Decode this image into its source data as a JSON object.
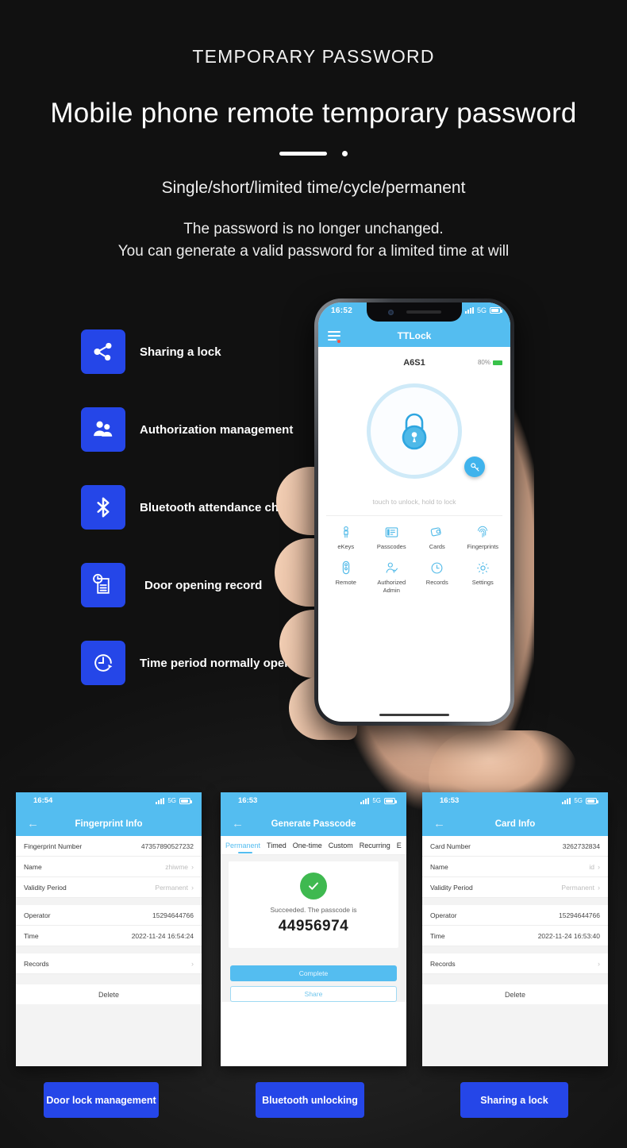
{
  "header": {
    "eyebrow": "TEMPORARY PASSWORD",
    "title": "Mobile phone remote temporary password",
    "subtitle": "Single/short/limited time/cycle/permanent",
    "desc_line1": "The password is no longer unchanged.",
    "desc_line2": "You can generate a valid password for a limited time at will"
  },
  "colors": {
    "background": "#111111",
    "brand_blue": "#2546e8",
    "app_blue": "#54bdf0",
    "success_green": "#3fb950"
  },
  "features": [
    {
      "icon": "share-icon",
      "label": "Sharing a lock"
    },
    {
      "icon": "users-icon",
      "label": "Authorization management"
    },
    {
      "icon": "bluetooth-icon",
      "label": "Bluetooth attendance check"
    },
    {
      "icon": "document-clock-icon",
      "label": "Door opening record"
    },
    {
      "icon": "clock-arrow-icon",
      "label": "Time period normally open"
    }
  ],
  "hero_phone": {
    "status": {
      "time": "16:52",
      "network": "5G",
      "signal": "signal-bars-icon",
      "battery": "battery-icon"
    },
    "appbar": {
      "menu": "hamburger-icon",
      "title": "TTLock"
    },
    "lock": {
      "name": "A6S1",
      "battery_percent": "80%",
      "hint": "touch to unlock, hold to lock",
      "lock_icon": "padlock-icon",
      "fab_icon": "key-icon"
    },
    "grid": [
      {
        "icon": "ekey-icon",
        "label": "eKeys"
      },
      {
        "icon": "passcode-icon",
        "label": "Passcodes"
      },
      {
        "icon": "card-icon",
        "label": "Cards"
      },
      {
        "icon": "fingerprint-icon",
        "label": "Fingerprints"
      },
      {
        "icon": "remote-icon",
        "label": "Remote"
      },
      {
        "icon": "admin-icon",
        "label": "Authorized\nAdmin"
      },
      {
        "icon": "history-icon",
        "label": "Records"
      },
      {
        "icon": "gear-icon",
        "label": "Settings"
      }
    ]
  },
  "shots": {
    "fingerprint": {
      "status_time": "16:54",
      "network": "5G",
      "title": "Fingerprint Info",
      "rows": [
        {
          "label": "Fingerprint Number",
          "value": "47357890527232",
          "muted": false,
          "chevron": false
        },
        {
          "label": "Name",
          "value": "zhiwme",
          "muted": true,
          "chevron": true
        },
        {
          "label": "Validity Period",
          "value": "Permanent",
          "muted": true,
          "chevron": true
        },
        {
          "label": "Operator",
          "value": "15294644766",
          "muted": false,
          "chevron": false
        },
        {
          "label": "Time",
          "value": "2022-11-24 16:54:24",
          "muted": false,
          "chevron": false
        },
        {
          "label": "Records",
          "value": "",
          "muted": false,
          "chevron": true
        }
      ],
      "delete": "Delete"
    },
    "passcode": {
      "status_time": "16:53",
      "network": "5G",
      "title": "Generate Passcode",
      "tabs": [
        "Permanent",
        "Timed",
        "One-time",
        "Custom",
        "Recurring",
        "E"
      ],
      "active_tab": "Permanent",
      "success_text": "Succeeded. The passcode is",
      "passcode": "44956974",
      "primary_button": "Complete",
      "secondary_button": "Share"
    },
    "card": {
      "status_time": "16:53",
      "network": "5G",
      "title": "Card Info",
      "rows": [
        {
          "label": "Card Number",
          "value": "3262732834",
          "muted": false,
          "chevron": false
        },
        {
          "label": "Name",
          "value": "id",
          "muted": true,
          "chevron": true
        },
        {
          "label": "Validity Period",
          "value": "Permanent",
          "muted": true,
          "chevron": true
        },
        {
          "label": "Operator",
          "value": "15294644766",
          "muted": false,
          "chevron": false
        },
        {
          "label": "Time",
          "value": "2022-11-24 16:53:40",
          "muted": false,
          "chevron": false
        },
        {
          "label": "Records",
          "value": "",
          "muted": false,
          "chevron": true
        }
      ],
      "delete": "Delete"
    }
  },
  "ctas": [
    {
      "label": "Door lock management"
    },
    {
      "label": "Bluetooth unlocking"
    },
    {
      "label": "Sharing a lock"
    }
  ]
}
